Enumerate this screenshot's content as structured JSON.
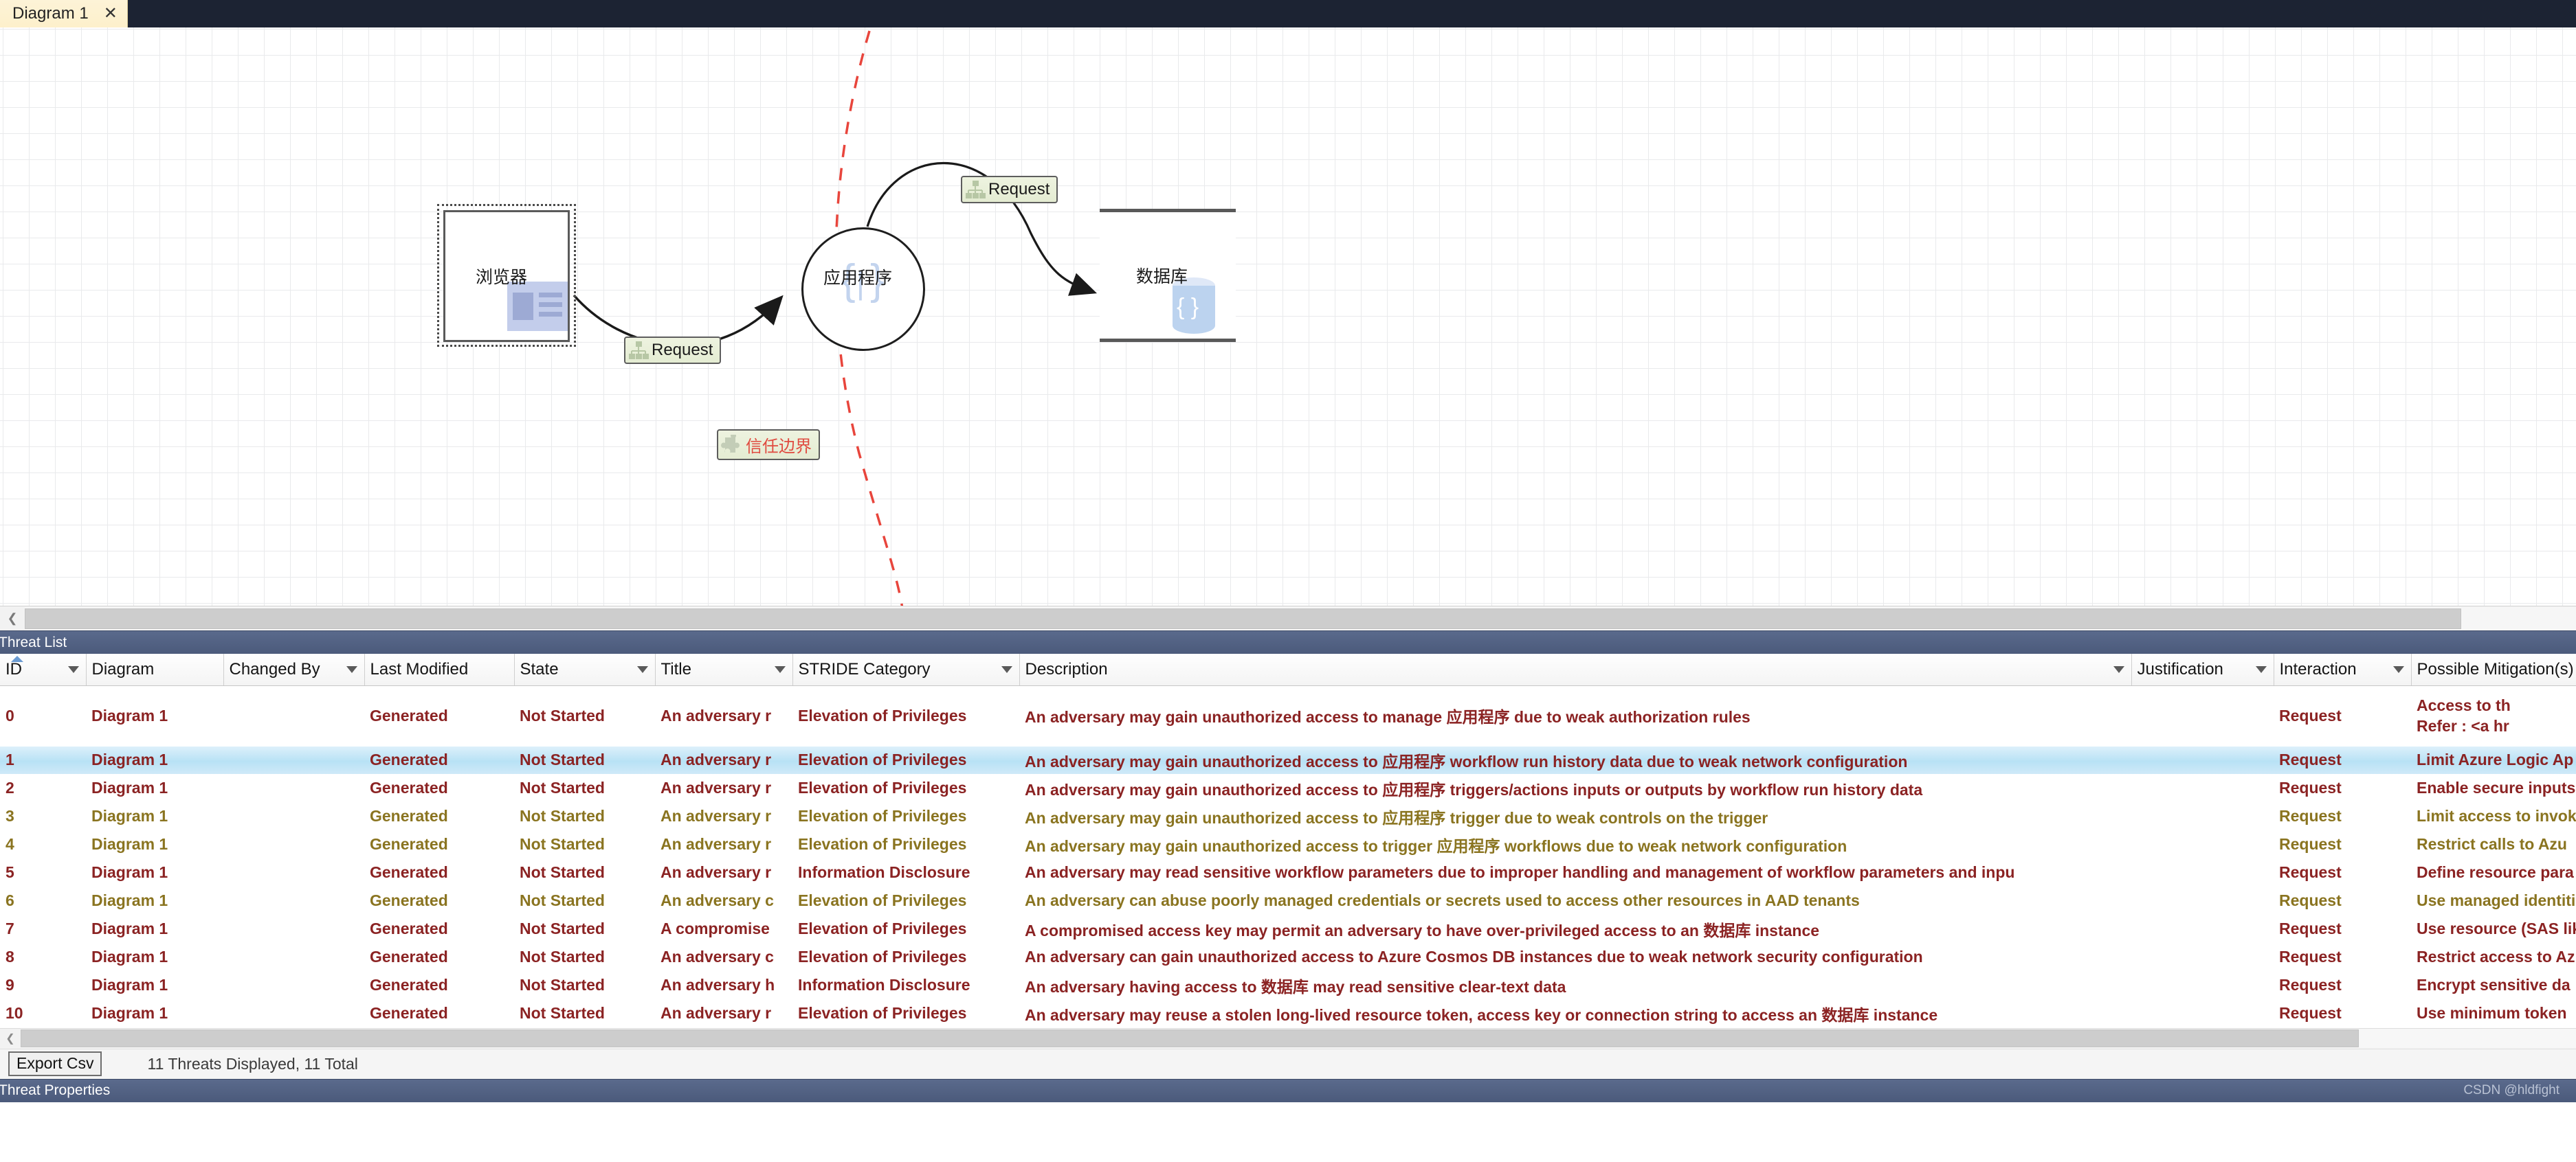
{
  "tab": {
    "title": "Diagram 1",
    "close_icon": "close-icon"
  },
  "diagram": {
    "nodes": [
      {
        "id": "browser",
        "label": "浏览器",
        "type": "external-entity",
        "selected": true
      },
      {
        "id": "application",
        "label": "应用程序",
        "type": "process"
      },
      {
        "id": "database",
        "label": "数据库",
        "type": "data-store"
      }
    ],
    "flows": [
      {
        "id": "flow1",
        "label": "Request",
        "from": "browser",
        "to": "application"
      },
      {
        "id": "flow2",
        "label": "Request",
        "from": "application",
        "to": "database"
      }
    ],
    "boundary": {
      "label": "信任边界",
      "color": "#e04a3f",
      "style": "dashed"
    }
  },
  "threat_list": {
    "panel_title": "Threat List",
    "columns": [
      {
        "key": "id",
        "label": "ID",
        "sorted": true,
        "has_filter": true
      },
      {
        "key": "diagram",
        "label": "Diagram",
        "has_filter": false
      },
      {
        "key": "changed_by",
        "label": "Changed By",
        "has_filter": true
      },
      {
        "key": "last_modified",
        "label": "Last Modified",
        "has_filter": false
      },
      {
        "key": "state",
        "label": "State",
        "has_filter": true
      },
      {
        "key": "title",
        "label": "Title",
        "has_filter": true
      },
      {
        "key": "stride",
        "label": "STRIDE Category",
        "has_filter": true
      },
      {
        "key": "description",
        "label": "Description",
        "has_filter": true
      },
      {
        "key": "justification",
        "label": "Justification",
        "has_filter": true
      },
      {
        "key": "interaction",
        "label": "Interaction",
        "has_filter": true
      },
      {
        "key": "mitigations",
        "label": "Possible Mitigation(s)",
        "has_filter": false
      }
    ],
    "rows": [
      {
        "id": "0",
        "diagram": "Diagram 1",
        "changed_by": "",
        "last_modified": "Generated",
        "state": "Not Started",
        "title": "An adversary r",
        "stride": "Elevation of Privileges",
        "description": "An adversary may gain unauthorized access to manage 应用程序 due to weak authorization rules",
        "justification": "",
        "interaction": "Request",
        "mitigations": "Access to th\nRefer : <a hr",
        "severity": "high",
        "selected": false,
        "tall": true
      },
      {
        "id": "1",
        "diagram": "Diagram 1",
        "changed_by": "",
        "last_modified": "Generated",
        "state": "Not Started",
        "title": "An adversary r",
        "stride": "Elevation of Privileges",
        "description": "An adversary may gain unauthorized access to 应用程序 workflow run history data due to weak network configuration",
        "justification": "",
        "interaction": "Request",
        "mitigations": "Limit Azure Logic Ap",
        "severity": "high",
        "selected": true,
        "tall": false
      },
      {
        "id": "2",
        "diagram": "Diagram 1",
        "changed_by": "",
        "last_modified": "Generated",
        "state": "Not Started",
        "title": "An adversary r",
        "stride": "Elevation of Privileges",
        "description": "An adversary may gain unauthorized access to 应用程序 triggers/actions inputs or outputs by workflow run history data",
        "justification": "",
        "interaction": "Request",
        "mitigations": "Enable secure inputs",
        "severity": "high",
        "selected": false,
        "tall": false
      },
      {
        "id": "3",
        "diagram": "Diagram 1",
        "changed_by": "",
        "last_modified": "Generated",
        "state": "Not Started",
        "title": "An adversary r",
        "stride": "Elevation of Privileges",
        "description": "An adversary may gain unauthorized access to 应用程序 trigger due to weak controls on the trigger",
        "justification": "",
        "interaction": "Request",
        "mitigations": "Limit access to invok",
        "severity": "med",
        "selected": false,
        "tall": false
      },
      {
        "id": "4",
        "diagram": "Diagram 1",
        "changed_by": "",
        "last_modified": "Generated",
        "state": "Not Started",
        "title": "An adversary r",
        "stride": "Elevation of Privileges",
        "description": "An adversary may gain unauthorized access to trigger 应用程序 workflows due to weak network configuration",
        "justification": "",
        "interaction": "Request",
        "mitigations": "Restrict calls to Azu",
        "severity": "med",
        "selected": false,
        "tall": false
      },
      {
        "id": "5",
        "diagram": "Diagram 1",
        "changed_by": "",
        "last_modified": "Generated",
        "state": "Not Started",
        "title": "An adversary r",
        "stride": "Information Disclosure",
        "description": "An adversary may read sensitive workflow parameters due to improper handling and management of workflow parameters and inpu",
        "justification": "",
        "interaction": "Request",
        "mitigations": "Define resource para",
        "severity": "high",
        "selected": false,
        "tall": false
      },
      {
        "id": "6",
        "diagram": "Diagram 1",
        "changed_by": "",
        "last_modified": "Generated",
        "state": "Not Started",
        "title": "An adversary c",
        "stride": "Elevation of Privileges",
        "description": "An adversary can abuse poorly managed credentials or secrets used to access other resources in AAD tenants",
        "justification": "",
        "interaction": "Request",
        "mitigations": "Use managed identiti",
        "severity": "med",
        "selected": false,
        "tall": false
      },
      {
        "id": "7",
        "diagram": "Diagram 1",
        "changed_by": "",
        "last_modified": "Generated",
        "state": "Not Started",
        "title": "A compromise",
        "stride": "Elevation of Privileges",
        "description": "A compromised access key may permit an adversary to have over-privileged access to an 数据库 instance",
        "justification": "",
        "interaction": "Request",
        "mitigations": "Use resource (SAS lik",
        "severity": "high",
        "selected": false,
        "tall": false
      },
      {
        "id": "8",
        "diagram": "Diagram 1",
        "changed_by": "",
        "last_modified": "Generated",
        "state": "Not Started",
        "title": "An adversary c",
        "stride": "Elevation of Privileges",
        "description": "An adversary can gain unauthorized access to Azure Cosmos DB instances due to weak network security configuration",
        "justification": "",
        "interaction": "Request",
        "mitigations": "Restrict access to Az",
        "severity": "high",
        "selected": false,
        "tall": false
      },
      {
        "id": "9",
        "diagram": "Diagram 1",
        "changed_by": "",
        "last_modified": "Generated",
        "state": "Not Started",
        "title": "An adversary h",
        "stride": "Information Disclosure",
        "description": "An adversary having access to 数据库 may read sensitive clear-text data",
        "justification": "",
        "interaction": "Request",
        "mitigations": "Encrypt sensitive da",
        "severity": "high",
        "selected": false,
        "tall": false
      },
      {
        "id": "10",
        "diagram": "Diagram 1",
        "changed_by": "",
        "last_modified": "Generated",
        "state": "Not Started",
        "title": "An adversary r",
        "stride": "Elevation of Privileges",
        "description": "An adversary may reuse a stolen long-lived resource token, access key or connection string to access an 数据库 instance",
        "justification": "",
        "interaction": "Request",
        "mitigations": "Use minimum token",
        "severity": "high",
        "selected": false,
        "tall": false
      }
    ]
  },
  "footer": {
    "export_label": "Export Csv",
    "status": "11 Threats Displayed, 11 Total"
  },
  "threat_properties": {
    "panel_title": "Threat Properties",
    "watermark": "CSDN @hldfight"
  },
  "colors": {
    "tab_bg": "#fdf3d7",
    "titlebar_bg": "#1c2333",
    "panel_header": "#4b5a7b",
    "severity_high": "#8b2323",
    "severity_medium": "#8a7420",
    "selection": "#b8e2f5",
    "boundary_red": "#e04a3f",
    "flow_chip_green": "#e4ecd2"
  }
}
